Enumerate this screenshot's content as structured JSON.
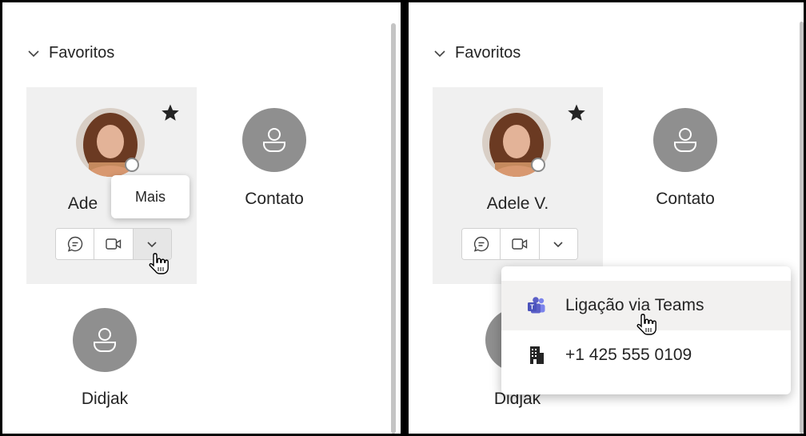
{
  "section": {
    "title": "Favoritos"
  },
  "favorite": {
    "name_left": "Ade",
    "name_right": "Adele V."
  },
  "contacts": {
    "contato": "Contato",
    "didjak": "Didjak"
  },
  "tooltip": {
    "label": "Mais"
  },
  "menu": {
    "items": [
      {
        "label": "Ligação via Teams",
        "icon": "teams-icon"
      },
      {
        "label": "+1 425 555 0109",
        "icon": "building-icon"
      }
    ]
  },
  "colors": {
    "card_bg": "#f0f0f0",
    "avatar_gray": "#8f8f8f",
    "teams_purple": "#5b5fc7"
  }
}
